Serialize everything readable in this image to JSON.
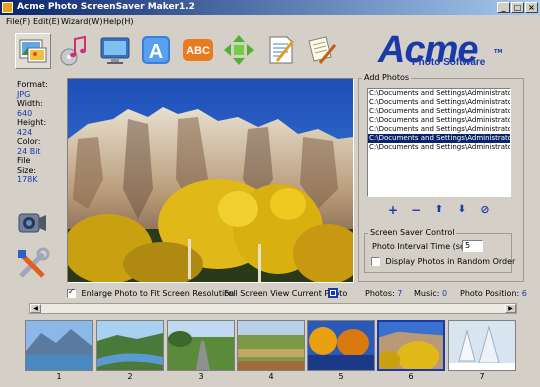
{
  "window": {
    "title": "Acme Photo ScreenSaver Maker1.2"
  },
  "menu": [
    {
      "label": "File(F)"
    },
    {
      "label": "Edit(E)"
    },
    {
      "label": "Wizard(W)"
    },
    {
      "label": "Help(H)"
    }
  ],
  "toolbar": [
    {
      "icon": "photos-icon"
    },
    {
      "icon": "music-icon"
    },
    {
      "icon": "monitor-icon"
    },
    {
      "icon": "text-icon"
    },
    {
      "icon": "abc-icon"
    },
    {
      "icon": "transition-arrows-icon"
    },
    {
      "icon": "document-icon"
    },
    {
      "icon": "edit-document-icon"
    }
  ],
  "logo": {
    "main": "Acme",
    "sub": "Photo Software",
    "tm": "TM"
  },
  "photo_info": {
    "format_label": "Format:",
    "format_value": "JPG",
    "width_label": "Width:",
    "width_value": "640",
    "height_label": "Height:",
    "height_value": "424",
    "color_label": "Color:",
    "color_value": "24 Bit",
    "filesize_label": "File Size:",
    "filesize_value": "178K"
  },
  "add_photos": {
    "title": "Add Photos",
    "files": [
      "C:\\Documents and Settings\\Administrator\\M",
      "C:\\Documents and Settings\\Administrator\\M",
      "C:\\Documents and Settings\\Administrator\\M",
      "C:\\Documents and Settings\\Administrator\\M",
      "C:\\Documents and Settings\\Administrator\\M",
      "C:\\Documents and Settings\\Administrator\\M",
      "C:\\Documents and Settings\\Administrator\\M"
    ],
    "selected_index": 5,
    "buttons": {
      "add": "+",
      "remove": "−",
      "up": "⬆",
      "down": "⬇",
      "clear": "⊘"
    }
  },
  "screen_saver_control": {
    "title": "Screen Saver Control",
    "interval_label": "Photo Interval Time (sec)",
    "interval_value": "5",
    "random_label": "Display Photos in Random Order",
    "random_checked": false
  },
  "options": {
    "enlarge_label": "Enlarge Photo to Fit Screen Resolution",
    "enlarge_checked": true,
    "fullscreen_label": "Full Screen View Current Photo"
  },
  "status": {
    "photos_label": "Photos:",
    "photos_value": "7",
    "music_label": "Music:",
    "music_value": "0",
    "position_label": "Photo Position:",
    "position_value": "6"
  },
  "thumbnails": [
    {
      "num": "1",
      "scene": "mountain-lake"
    },
    {
      "num": "2",
      "scene": "river-meadow"
    },
    {
      "num": "3",
      "scene": "country-road"
    },
    {
      "num": "4",
      "scene": "farm-fields"
    },
    {
      "num": "5",
      "scene": "autumn-lake"
    },
    {
      "num": "6",
      "scene": "canyon-aspens"
    },
    {
      "num": "7",
      "scene": "snowy-trees"
    }
  ],
  "selected_thumbnail": 6
}
